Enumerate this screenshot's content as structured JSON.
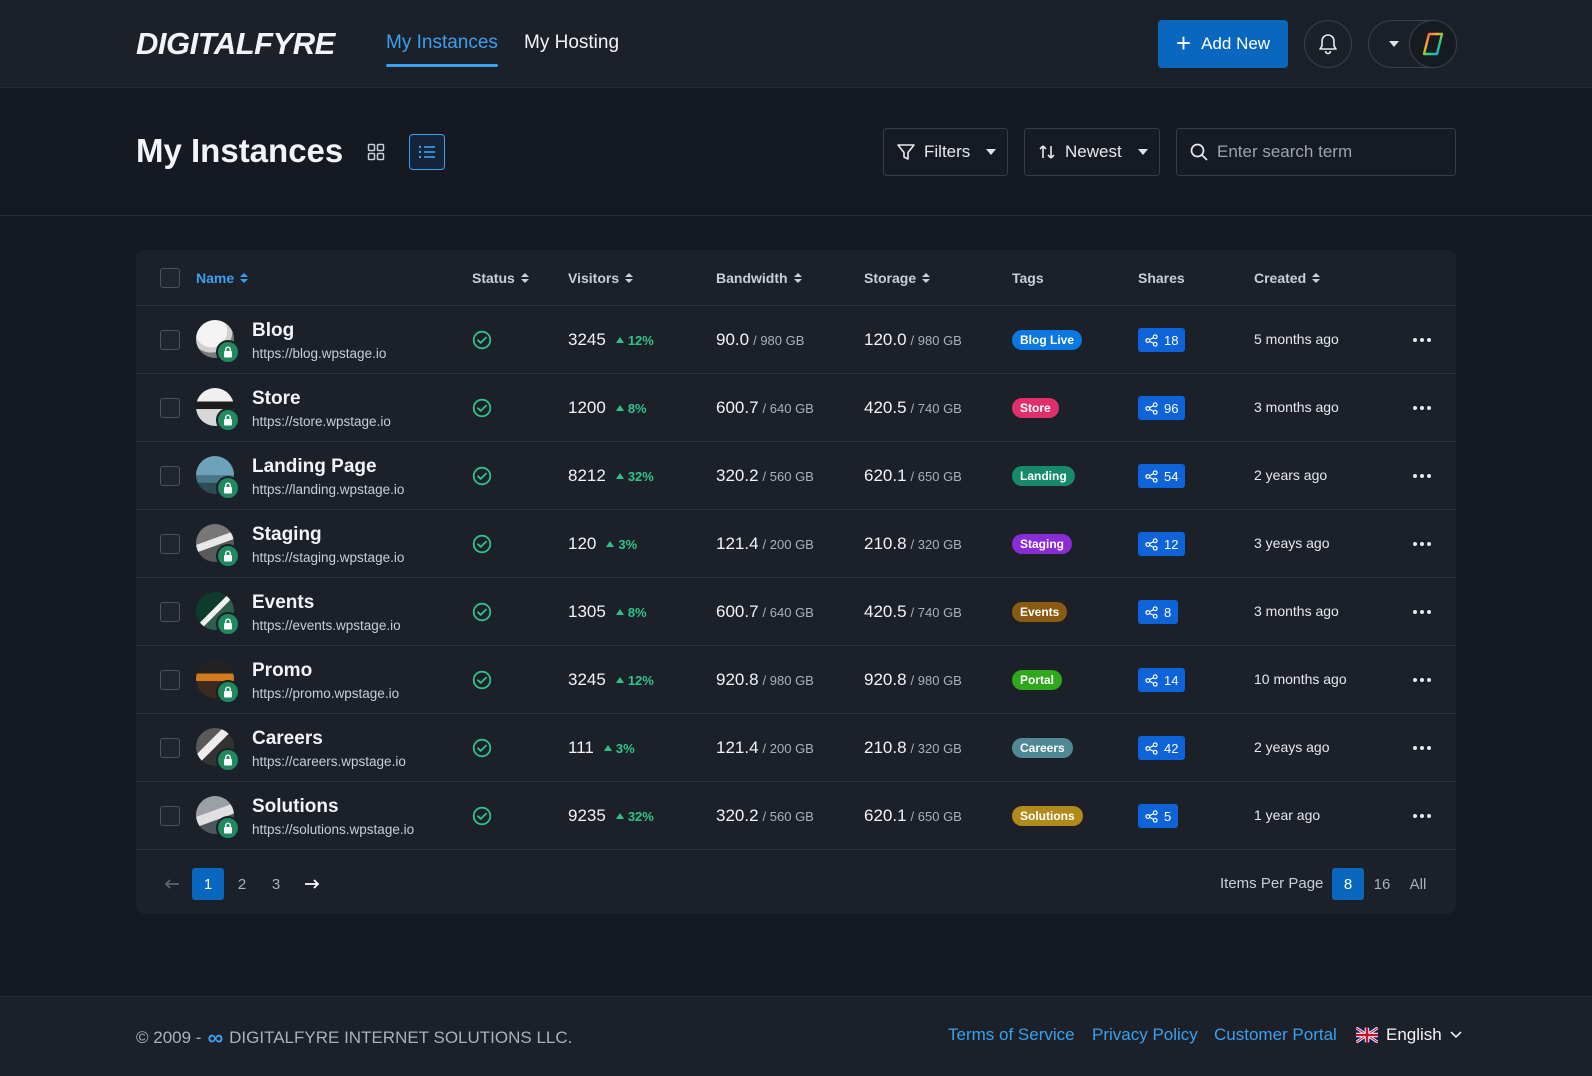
{
  "brand": {
    "logo_text": "DIGITALFYRE"
  },
  "nav": {
    "tabs": [
      {
        "label": "My Instances",
        "active": true
      },
      {
        "label": "My Hosting",
        "active": false
      }
    ],
    "add_new_label": "Add New",
    "icons": {
      "add": "plus-icon",
      "notifications": "bell-icon",
      "account_menu": "chevron-down-icon",
      "avatar": "brand-avatar"
    }
  },
  "header": {
    "title": "My Instances",
    "view_modes": [
      "grid",
      "list"
    ],
    "active_view": "list",
    "filters_label": "Filters",
    "sort_label": "Newest",
    "search_placeholder": "Enter search term"
  },
  "table": {
    "columns": {
      "name": "Name",
      "status": "Status",
      "visitors": "Visitors",
      "bandwidth": "Bandwidth",
      "storage": "Storage",
      "tags": "Tags",
      "shares": "Shares",
      "created": "Created"
    },
    "rows": [
      {
        "name": "Blog",
        "url": "https://blog.wpstage.io",
        "status": "active",
        "visitors": "3245",
        "trend": "12%",
        "bw_used": "90.0",
        "bw_total": "/ 980 GB",
        "st_used": "120.0",
        "st_total": "/ 980 GB",
        "tag": "Blog Live",
        "shares": "18",
        "created": "5 months ago"
      },
      {
        "name": "Store",
        "url": "https://store.wpstage.io",
        "status": "active",
        "visitors": "1200",
        "trend": "8%",
        "bw_used": "600.7",
        "bw_total": "/ 640 GB",
        "st_used": "420.5",
        "st_total": "/ 740 GB",
        "tag": "Store",
        "shares": "96",
        "created": "3 months ago"
      },
      {
        "name": "Landing Page",
        "url": "https://landing.wpstage.io",
        "status": "active",
        "visitors": "8212",
        "trend": "32%",
        "bw_used": "320.2",
        "bw_total": "/ 560 GB",
        "st_used": "620.1",
        "st_total": "/ 650 GB",
        "tag": "Landing",
        "shares": "54",
        "created": "2 years ago"
      },
      {
        "name": "Staging",
        "url": "https://staging.wpstage.io",
        "status": "active",
        "visitors": "120",
        "trend": "3%",
        "bw_used": "121.4",
        "bw_total": "/ 200 GB",
        "st_used": "210.8",
        "st_total": "/ 320 GB",
        "tag": "Staging",
        "shares": "12",
        "created": "3 yeays ago"
      },
      {
        "name": "Events",
        "url": "https://events.wpstage.io",
        "status": "active",
        "visitors": "1305",
        "trend": "8%",
        "bw_used": "600.7",
        "bw_total": "/ 640 GB",
        "st_used": "420.5",
        "st_total": "/ 740 GB",
        "tag": "Events",
        "shares": "8",
        "created": "3 months ago"
      },
      {
        "name": "Promo",
        "url": "https://promo.wpstage.io",
        "status": "active",
        "visitors": "3245",
        "trend": "12%",
        "bw_used": "920.8",
        "bw_total": "/ 980 GB",
        "st_used": "920.8",
        "st_total": "/ 980 GB",
        "tag": "Portal",
        "shares": "14",
        "created": "10 months ago"
      },
      {
        "name": "Careers",
        "url": "https://careers.wpstage.io",
        "status": "active",
        "visitors": "111",
        "trend": "3%",
        "bw_used": "121.4",
        "bw_total": "/ 200 GB",
        "st_used": "210.8",
        "st_total": "/ 320 GB",
        "tag": "Careers",
        "shares": "42",
        "created": "2 yeays ago"
      },
      {
        "name": "Solutions",
        "url": "https://solutions.wpstage.io",
        "status": "active",
        "visitors": "9235",
        "trend": "32%",
        "bw_used": "320.2",
        "bw_total": "/ 560 GB",
        "st_used": "620.1",
        "st_total": "/ 650 GB",
        "tag": "Solutions",
        "shares": "5",
        "created": "1 year ago"
      }
    ]
  },
  "tag_colors": {
    "Blog Live": "#0a78e0",
    "Store": "#e0306b",
    "Landing": "#168a6a",
    "Staging": "#8a2bd8",
    "Events": "#8a5a12",
    "Portal": "#2fa81c",
    "Careers": "#4f8a94",
    "Solutions": "#b08a1a"
  },
  "pagination": {
    "pages": [
      "1",
      "2",
      "3"
    ],
    "current_page": "1",
    "items_per_page_label": "Items Per Page",
    "items_per_page_options": [
      "8",
      "16",
      "All"
    ],
    "items_per_page_selected": "8"
  },
  "footer": {
    "copyright_prefix": "© 2009 -",
    "company": "DIGITALFYRE INTERNET SOLUTIONS LLC.",
    "links": [
      "Terms of Service",
      "Privacy Policy",
      "Customer Portal"
    ],
    "language": "English"
  },
  "colors": {
    "accent": "#3aa0f0",
    "primary_button": "#0a67c0",
    "status_ok": "#2fc38a",
    "share_badge": "#0f63d8",
    "lock_badge": "#1f8a5e"
  }
}
